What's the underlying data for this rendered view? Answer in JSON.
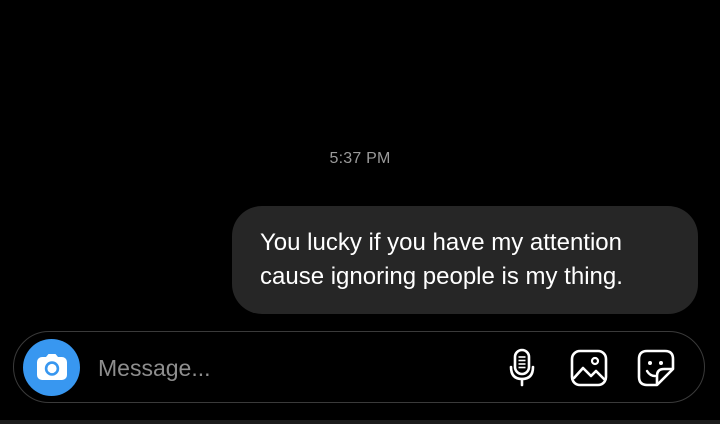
{
  "thread": {
    "timestamp": "5:37 PM",
    "messages": [
      {
        "direction": "outgoing",
        "lines": [
          "You lucky if you have my attention",
          "cause ignoring people is my thing."
        ]
      }
    ]
  },
  "composer": {
    "placeholder": "Message...",
    "value": "",
    "icons": {
      "camera": "camera-icon",
      "mic": "microphone-icon",
      "gallery": "gallery-icon",
      "sticker": "sticker-icon"
    }
  },
  "colors": {
    "background": "#000000",
    "bubble": "#262626",
    "accent": "#3897f0",
    "timestamp": "#9a9a9a",
    "placeholder": "#8e8e8e"
  }
}
